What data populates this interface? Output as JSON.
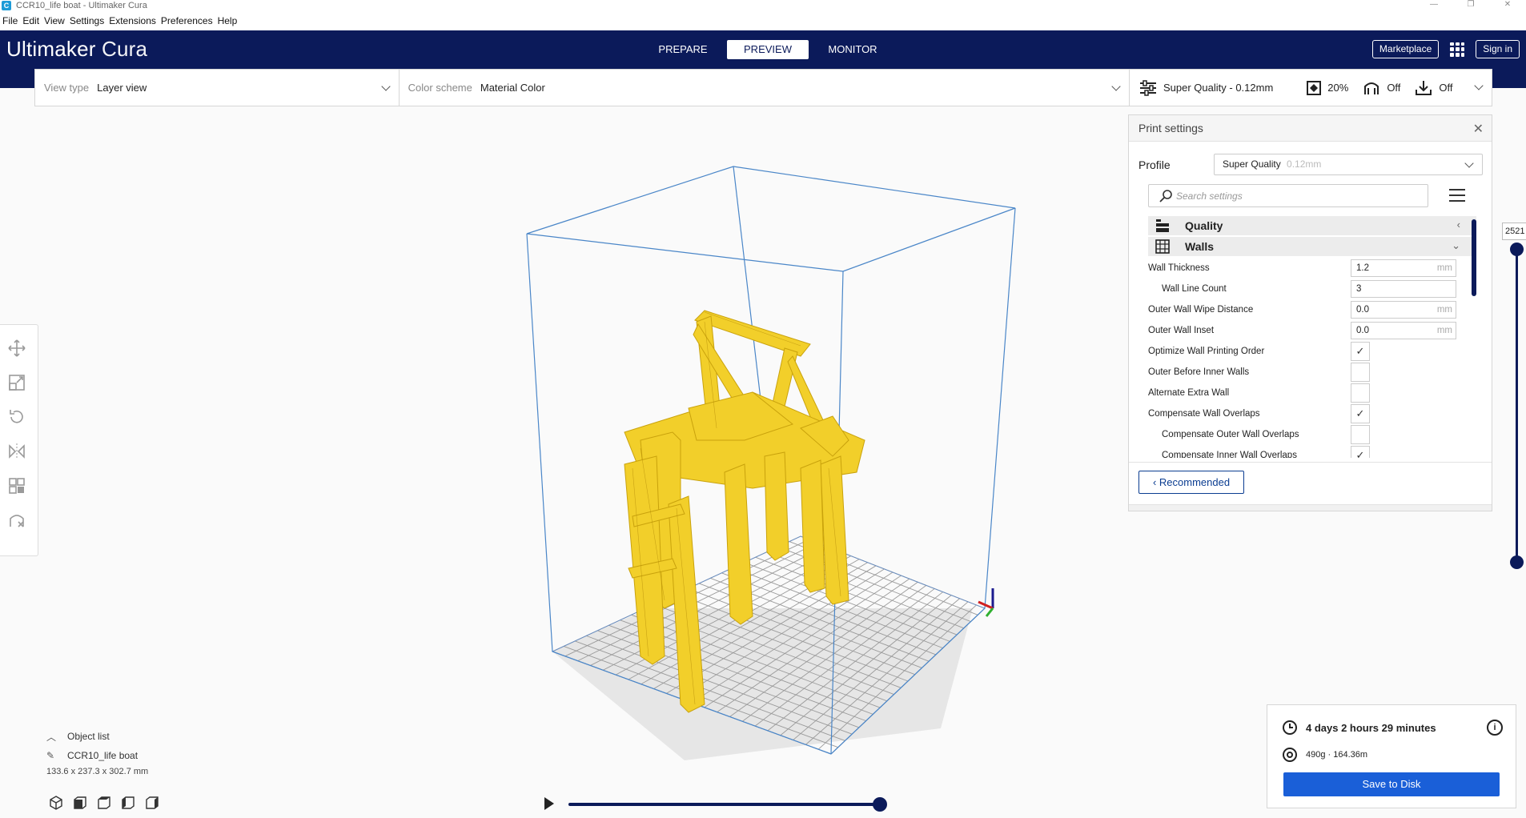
{
  "window": {
    "title": "CCR10_life boat - Ultimaker Cura",
    "app_icon": "C",
    "controls": [
      "—",
      "❐",
      "✕"
    ]
  },
  "menu": [
    "File",
    "Edit",
    "View",
    "Settings",
    "Extensions",
    "Preferences",
    "Help"
  ],
  "header": {
    "brand_primary": "Ultimaker",
    "brand_secondary": "Cura",
    "tabs": [
      {
        "label": "PREPARE"
      },
      {
        "label": "PREVIEW",
        "active": true
      },
      {
        "label": "MONITOR"
      }
    ],
    "marketplace": "Marketplace",
    "sign_in": "Sign in",
    "bg_color": "#0b1a5a"
  },
  "view_bar": {
    "view_type_label": "View type",
    "view_type_value": "Layer view",
    "color_scheme_label": "Color scheme",
    "color_scheme_value": "Material Color"
  },
  "quality_bar": {
    "profile": "Super Quality - 0.12mm",
    "infill": "20%",
    "support": "Off",
    "adhesion": "Off"
  },
  "print_settings": {
    "title": "Print settings",
    "profile_label": "Profile",
    "profile_value": "Super Quality",
    "profile_suffix": "0.12mm",
    "search_placeholder": "Search settings",
    "categories": [
      {
        "name": "Quality",
        "arrow": "‹"
      },
      {
        "name": "Walls",
        "arrow": "⌄"
      }
    ],
    "settings": [
      {
        "label": "Wall Thickness",
        "value": "1.2",
        "unit": "mm",
        "type": "input"
      },
      {
        "label": "Wall Line Count",
        "value": "3",
        "unit": "",
        "type": "input",
        "sub": true
      },
      {
        "label": "Outer Wall Wipe Distance",
        "value": "0.0",
        "unit": "mm",
        "type": "input"
      },
      {
        "label": "Outer Wall Inset",
        "value": "0.0",
        "unit": "mm",
        "type": "input"
      },
      {
        "label": "Optimize Wall Printing Order",
        "checked": true,
        "type": "check"
      },
      {
        "label": "Outer Before Inner Walls",
        "checked": false,
        "type": "check"
      },
      {
        "label": "Alternate Extra Wall",
        "checked": false,
        "type": "check"
      },
      {
        "label": "Compensate Wall Overlaps",
        "checked": true,
        "type": "check"
      },
      {
        "label": "Compensate Outer Wall Overlaps",
        "checked": false,
        "type": "check",
        "sub": true
      },
      {
        "label": "Compensate Inner Wall Overlaps",
        "checked": true,
        "type": "check",
        "sub": true
      }
    ],
    "recommended_button": "Recommended"
  },
  "layer_slider": {
    "value": "2521"
  },
  "object_list": {
    "label": "Object list",
    "object_name": "CCR10_life boat",
    "dimensions": "133.6 x 237.3 x 302.7 mm"
  },
  "print_info": {
    "time": "4 days 2 hours 29 minutes",
    "material": "490g · 164.36m",
    "save_button": "Save to Disk",
    "accent": "#1a5fd8"
  },
  "model_color": "#f2cf2a"
}
